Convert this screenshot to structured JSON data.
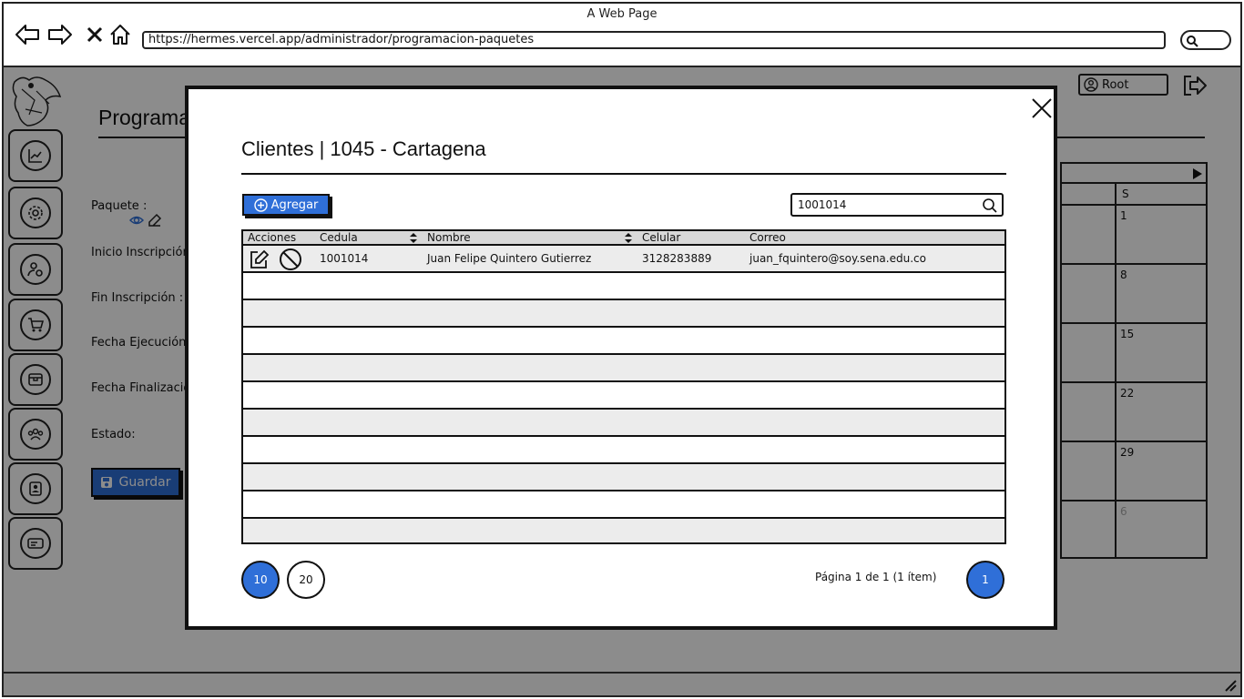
{
  "browser": {
    "title": "A Web Page",
    "url": "https://hermes.vercel.app/administrador/programacion-paquetes"
  },
  "header": {
    "user_label": "Root"
  },
  "page": {
    "title": "Programa",
    "labels": {
      "paquete": "Paquete :",
      "inicio": "Inicio Inscripción :",
      "fin": "Fin Inscripción :",
      "ejecucion": "Fecha Ejecución :",
      "finalizacion": "Fecha Finalización",
      "estado": "Estado:"
    },
    "save_label": "Guardar"
  },
  "calendar": {
    "day_header": "S",
    "days": [
      "1",
      "8",
      "15",
      "22",
      "29",
      "6"
    ]
  },
  "modal": {
    "title": "Clientes | 1045 - Cartagena",
    "add_label": "Agregar",
    "search_value": "1001014",
    "columns": [
      "Acciones",
      "Cedula",
      "Nombre",
      "Celular",
      "Correo"
    ],
    "rows": [
      {
        "cedula": "1001014",
        "nombre": "Juan Felipe Quintero Gutierrez",
        "celular": "3128283889",
        "correo": "juan_fquintero@soy.sena.edu.co"
      }
    ],
    "page_sizes": [
      "10",
      "20"
    ],
    "page_info": "Página 1 de 1 (1 ítem)",
    "current_page": "1"
  },
  "colors": {
    "accent": "#2f6fd8"
  },
  "icons": {
    "sidebar": [
      "chart-icon",
      "settings-icon",
      "user-settings-icon",
      "cart-icon",
      "box-icon",
      "group-icon",
      "contact-icon",
      "ticket-icon"
    ]
  }
}
